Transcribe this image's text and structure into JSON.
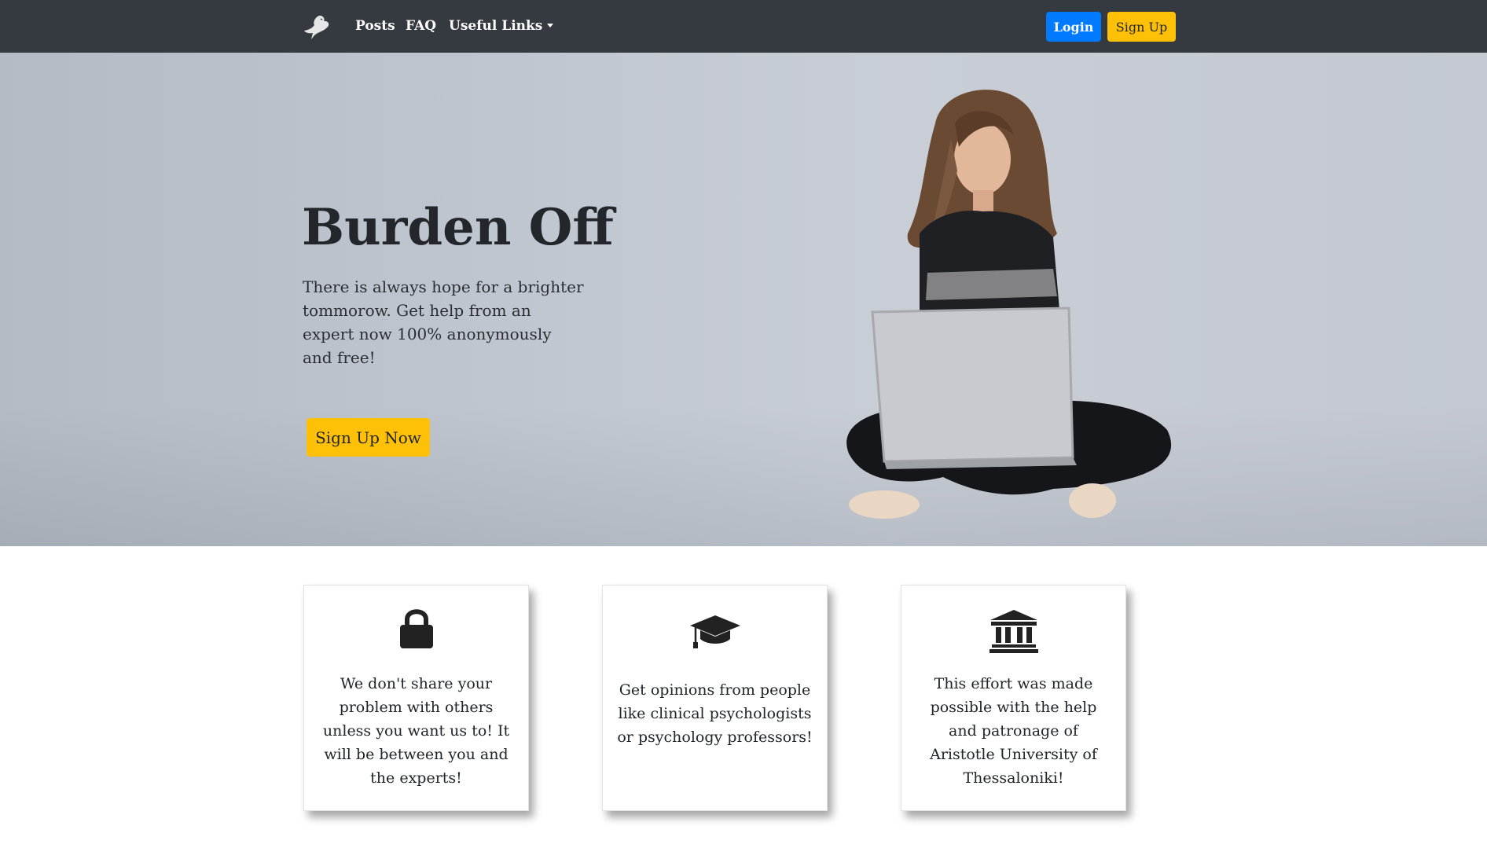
{
  "navbar": {
    "brand_icon": "bird-logo-icon",
    "links": [
      "Posts",
      "FAQ",
      "Useful Links"
    ],
    "login_label": "Login",
    "signup_label": "Sign Up",
    "colors": {
      "background": "#343a40",
      "login": "#007bff",
      "signup": "#ffc107"
    }
  },
  "hero": {
    "title": "Burden Off",
    "text": "There is always hope for a brighter tommorow. Get help from an expert now 100% anonymously and free!",
    "cta_label": "Sign Up Now",
    "image": "woman-with-laptop-photo"
  },
  "features": [
    {
      "icon": "lock-icon",
      "text": "We don't share your problem with others unless you want us to! It will be between you and the experts!"
    },
    {
      "icon": "graduation-cap-icon",
      "text": "Get opinions from people like clinical psychologists or psychology professors!"
    },
    {
      "icon": "university-icon",
      "text": "This effort was made possible with the help and patronage of Aristotle University of Thessaloniki!"
    }
  ]
}
